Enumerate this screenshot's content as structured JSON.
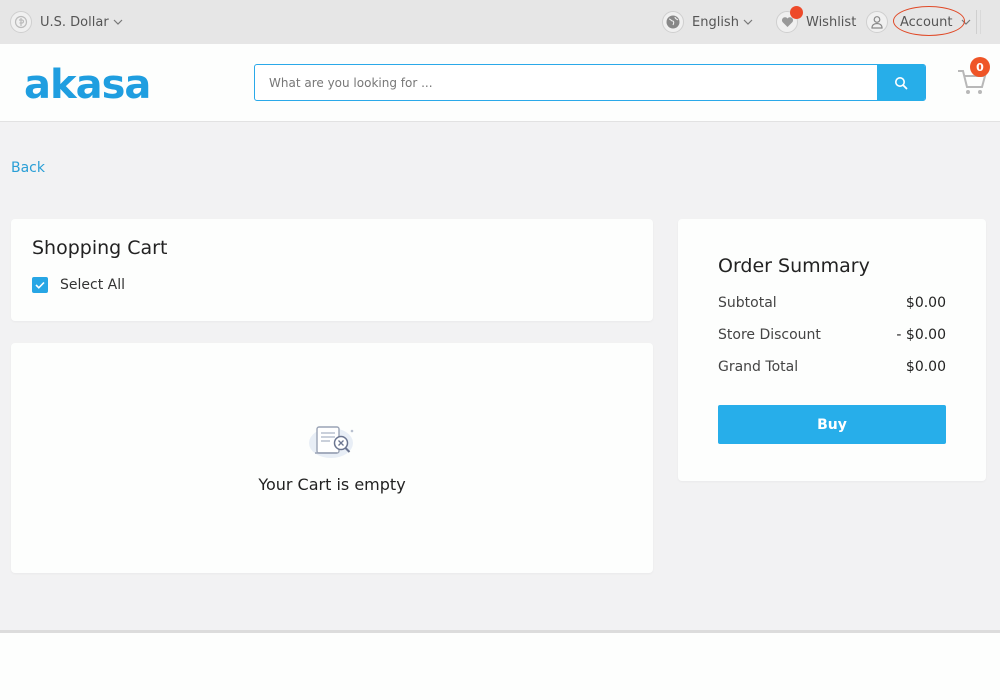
{
  "topbar": {
    "currency_label": "U.S. Dollar",
    "language_label": "English",
    "wishlist_label": "Wishlist",
    "account_label": "Account"
  },
  "header": {
    "logo_text": "akasa",
    "search_placeholder": "What are you looking for ...",
    "cart_count": "0"
  },
  "nav": {
    "back_label": "Back"
  },
  "cart": {
    "title": "Shopping Cart",
    "select_all_label": "Select All",
    "select_all_checked": true,
    "empty_message": "Your Cart is empty"
  },
  "summary": {
    "title": "Order Summary",
    "rows": [
      {
        "label": "Subtotal",
        "value": "$0.00"
      },
      {
        "label": "Store Discount",
        "value": "- $0.00"
      },
      {
        "label": "Grand Total",
        "value": "$0.00"
      }
    ],
    "buy_label": "Buy"
  },
  "colors": {
    "accent": "#27aeea",
    "brand": "#1f9ee0",
    "badge": "#ef5527",
    "link": "#2a9fd6"
  },
  "icons": [
    "currency-icon",
    "globe-icon",
    "heart-icon",
    "user-icon",
    "search-icon",
    "cart-icon",
    "check-icon",
    "empty-cart-icon",
    "chevron-down-icon"
  ]
}
